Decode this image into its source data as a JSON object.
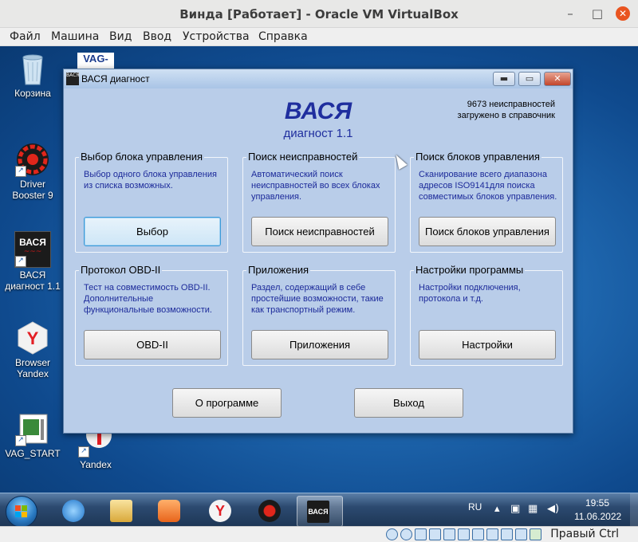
{
  "vbox": {
    "title": "Винда [Работает] - Oracle VM VirtualBox",
    "menu": [
      "Файл",
      "Машина",
      "Вид",
      "Ввод",
      "Устройства",
      "Справка"
    ],
    "controls": {
      "minimize": "–",
      "maximize": "□",
      "close": "✕"
    },
    "host_key": "Правый Ctrl"
  },
  "desktop": {
    "icons": [
      {
        "label": "Корзина",
        "icon": "recycle-bin-icon"
      },
      {
        "label": "Driver Booster 9",
        "icon": "driver-booster-icon"
      },
      {
        "label": "ВАСЯ диагност 1.1",
        "icon": "vasya-icon"
      },
      {
        "label": "Browser Yandex",
        "icon": "yandex-browser-icon"
      },
      {
        "label": "VAG_START",
        "icon": "vag-start-icon"
      },
      {
        "label": "Yandex",
        "icon": "yandex-icon"
      }
    ],
    "partial_icon_text": "VAG-"
  },
  "app": {
    "title": "ВАСЯ диагност",
    "icon_text": "ВАСЯ",
    "brand": "ВАСЯ",
    "subtitle": "диагност 1.1",
    "stats": [
      "9673 неисправностей",
      "загружено в справочник"
    ],
    "groups": [
      {
        "title": "Выбор блока управления",
        "desc": "Выбор одного блока управления из списка возможных.",
        "button": "Выбор"
      },
      {
        "title": "Поиск неисправностей",
        "desc": "Автоматический поиск неисправностей во всех блоках управления.",
        "button": "Поиск неисправностей"
      },
      {
        "title": "Поиск блоков управления",
        "desc": "Сканирование всего диапазона адресов ISO9141для поиска совместимых блоков управления.",
        "button": "Поиск блоков управления"
      },
      {
        "title": "Протокол OBD-II",
        "desc": "Тест на совместимость OBD-II. Дополнительные функциональные возможности.",
        "button": "OBD-II"
      },
      {
        "title": "Приложения",
        "desc": "Раздел, содержащий в себе простейшие возможности, такие как транспортный режим.",
        "button": "Приложения"
      },
      {
        "title": "Настройки программы",
        "desc": "Настройки подключения, протокола и т.д.",
        "button": "Настройки"
      }
    ],
    "about_button": "О программе",
    "exit_button": "Выход"
  },
  "taskbar": {
    "items": [
      "internet-explorer-icon",
      "file-explorer-icon",
      "media-player-icon",
      "yandex-browser-icon",
      "driver-booster-icon",
      "vasya-icon"
    ],
    "language": "RU",
    "time": "19:55",
    "date": "11.06.2022"
  },
  "colors": {
    "app_bg": "#b9cde9",
    "brand_blue": "#1f2e9e",
    "taskbar": "#2c4a70"
  }
}
